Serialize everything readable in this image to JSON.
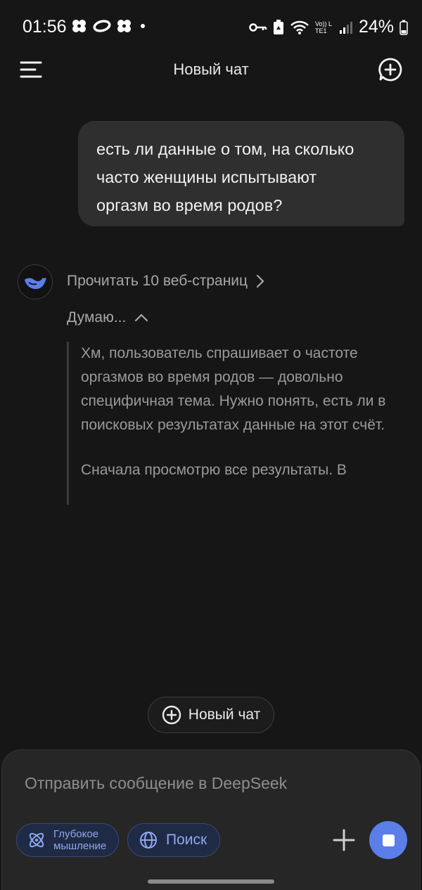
{
  "status_bar": {
    "time": "01:56",
    "battery": "24%",
    "network": "Vo)) LTE1"
  },
  "header": {
    "title": "Новый чат"
  },
  "conversation": {
    "user_message": "есть ли данные о том, на сколько\nчасто женщины испытывают\nоргазм во время родов?",
    "assistant": {
      "read_pages_label": "Прочитать 10 веб-страниц",
      "thinking_label": "Думаю...",
      "thought_paragraphs": [
        "Хм, пользователь спрашивает о частоте оргазмов во время родов — довольно специфичная тема. Нужно понять, есть ли в поисковых результатах данные на этот счёт.",
        "Сначала просмотрю все результаты. В"
      ]
    }
  },
  "floating_button": {
    "label": "Новый чат"
  },
  "composer": {
    "placeholder": "Отправить сообщение в DeepSeek",
    "deep_thinking_label": "Глубокое\nмышление",
    "search_label": "Поиск"
  },
  "colors": {
    "background": "#161616",
    "accent": "#5b7ee8",
    "chip_text": "#8fa8f0"
  }
}
